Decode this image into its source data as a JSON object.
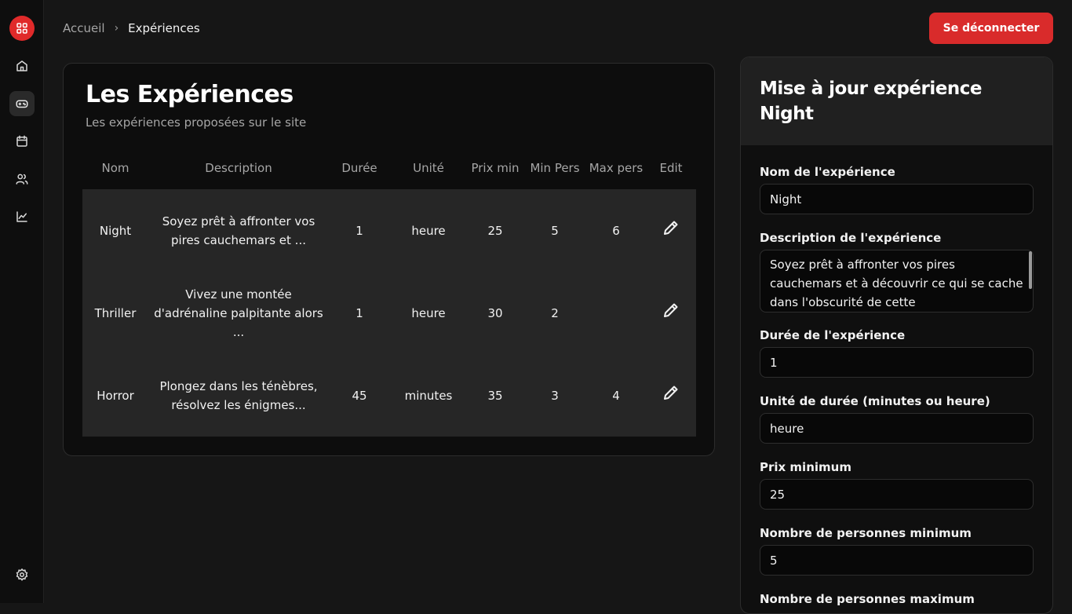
{
  "sidebar": {
    "items": [
      {
        "icon": "home-icon"
      },
      {
        "icon": "gamepad-icon",
        "active": true
      },
      {
        "icon": "calendar-icon"
      },
      {
        "icon": "users-icon"
      },
      {
        "icon": "chart-icon"
      }
    ],
    "settings_icon": "gear-icon",
    "logo_icon": "grid-icon"
  },
  "header": {
    "breadcrumb_home": "Accueil",
    "breadcrumb_sep": "›",
    "breadcrumb_current": "Expériences",
    "logout_label": "Se déconnecter"
  },
  "main": {
    "title": "Les Expériences",
    "subtitle": "Les expériences proposées sur le site",
    "columns": [
      "Nom",
      "Description",
      "Durée",
      "Unité",
      "Prix min",
      "Min Pers",
      "Max pers",
      "Edit"
    ],
    "rows": [
      {
        "nom": "Night",
        "description": "Soyez prêt à affronter vos pires cauchemars et ...",
        "duree": "1",
        "unite": "heure",
        "prix_min": "25",
        "min_pers": "5",
        "max_pers": "6"
      },
      {
        "nom": "Thriller",
        "description": "Vivez une montée d'adrénaline palpitante alors ...",
        "duree": "1",
        "unite": "heure",
        "prix_min": "30",
        "min_pers": "2",
        "max_pers": ""
      },
      {
        "nom": "Horror",
        "description": "Plongez dans les ténèbres, résolvez les énigmes...",
        "duree": "45",
        "unite": "minutes",
        "prix_min": "35",
        "min_pers": "3",
        "max_pers": "4"
      }
    ]
  },
  "panel": {
    "title": "Mise à jour expérience Night",
    "fields": {
      "nom": {
        "label": "Nom de l'expérience",
        "value": "Night"
      },
      "description": {
        "label": "Description de l'expérience",
        "value": "Soyez prêt à affronter vos pires cauchemars et à découvrir ce qui se cache dans l'obscurité de cette"
      },
      "duree": {
        "label": "Durée de l'expérience",
        "value": "1"
      },
      "unite": {
        "label": "Unité de durée (minutes ou heure)",
        "value": "heure"
      },
      "prix": {
        "label": "Prix minimum",
        "value": "25"
      },
      "min_pers": {
        "label": "Nombre de personnes minimum",
        "value": "5"
      },
      "max_pers": {
        "label": "Nombre de personnes maximum"
      }
    }
  },
  "colors": {
    "accent": "#d92b2b",
    "background": "#161616",
    "card": "#0d0d0d",
    "row": "#262626"
  }
}
